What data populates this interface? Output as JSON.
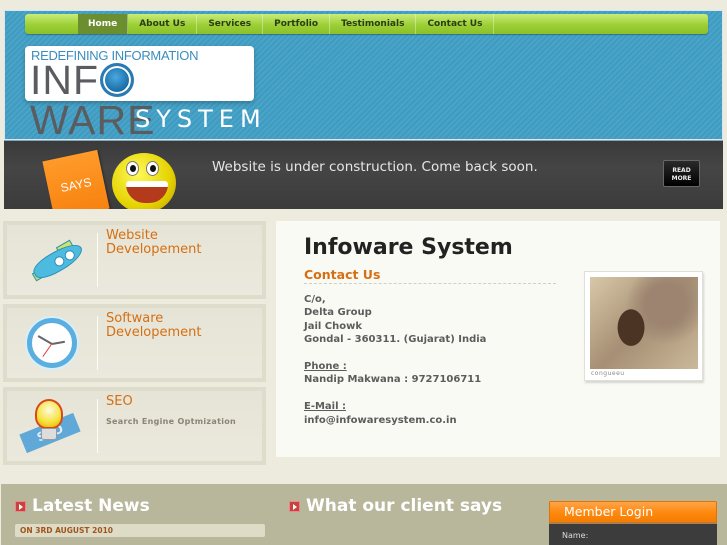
{
  "nav": {
    "items": [
      {
        "label": "Home",
        "active": true
      },
      {
        "label": "About Us",
        "active": false
      },
      {
        "label": "Services",
        "active": false
      },
      {
        "label": "Portfolio",
        "active": false
      },
      {
        "label": "Testimonials",
        "active": false
      },
      {
        "label": "Contact Us",
        "active": false
      }
    ]
  },
  "logo": {
    "tagline": "REDEFINING INFORMATION",
    "name_part1": "INF",
    "name_part2": "WARE",
    "system": "SYSTEM"
  },
  "banner": {
    "says_label": "SAYS",
    "message": "Website is under construction. Come back soon.",
    "read_more_line1": "READ",
    "read_more_line2": "MORE"
  },
  "services": [
    {
      "title_line1": "Website",
      "title_line2": "Developement",
      "subtitle": "",
      "icon": "rocket-icon"
    },
    {
      "title_line1": "Software",
      "title_line2": "Developement",
      "subtitle": "",
      "icon": "clock-icon"
    },
    {
      "title_line1": "SEO",
      "title_line2": "",
      "subtitle": "Search Engine Optmization",
      "icon": "lightbulb-seo-icon",
      "icon_text": "SEO"
    }
  ],
  "contact": {
    "title": "Infoware System",
    "subtitle": "Contact Us",
    "address": [
      "C/o,",
      "Delta Group",
      "Jail Chowk",
      "Gondal - 360311. (Gujarat) India"
    ],
    "phone_label": "Phone :",
    "phone_value": "Nandip Makwana : 9727106711",
    "email_label": "E-Mail :",
    "email_value": "info@infowaresystem.co.in",
    "photo_caption": "congueeu"
  },
  "footer": {
    "news_title": "Latest News",
    "news_date": "ON 3RD AUGUST 2010",
    "client_title": "What our client says",
    "login_title": "Member Login",
    "login_name_label": "Name:"
  },
  "colors": {
    "accent_orange": "#d56f13",
    "nav_green": "#9ccf35",
    "header_blue": "#4aa4c8",
    "login_orange": "#ff8a10"
  }
}
